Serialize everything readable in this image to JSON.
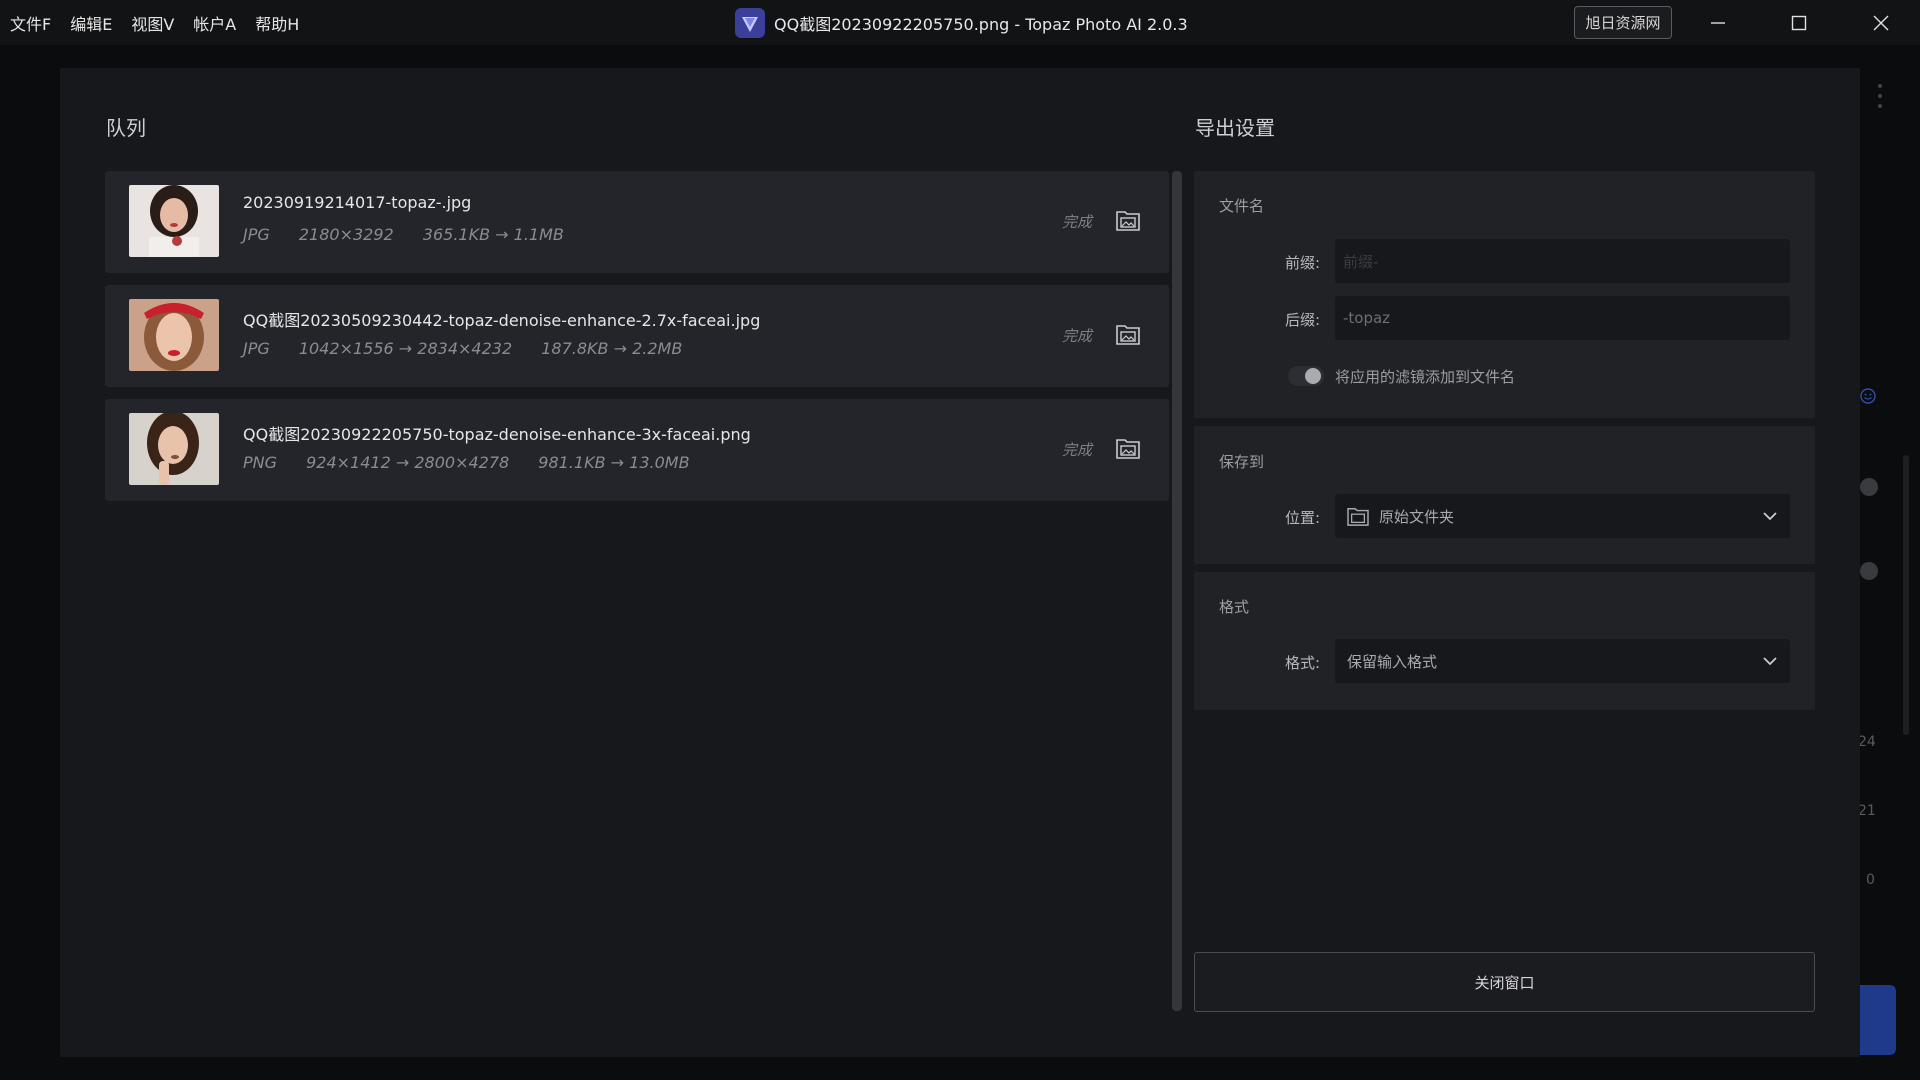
{
  "menu": [
    {
      "label": "文件F"
    },
    {
      "label": "编辑E"
    },
    {
      "label": "视图V"
    },
    {
      "label": "帐户A"
    },
    {
      "label": "帮助H"
    }
  ],
  "window": {
    "title": "QQ截图20230922205750.png - Topaz Photo AI 2.0.3",
    "badge": "旭日资源网"
  },
  "background_numbers": [
    "24",
    "21",
    "0"
  ],
  "queue": {
    "title": "队列",
    "items": [
      {
        "name": "20230919214017-topaz-.jpg",
        "format": "JPG",
        "dimensions": "2180×3292",
        "size": "365.1KB → 1.1MB",
        "status": "完成",
        "thumb_bg": "#e9e4e1",
        "thumb_hair": "#2a1d18",
        "thumb_skin": "#e5bba5",
        "thumb_accent": "#b43c3c"
      },
      {
        "name": "QQ截图20230509230442-topaz-denoise-enhance-2.7x-faceai.jpg",
        "format": "JPG",
        "dimensions": "1042×1556 → 2834×4232",
        "size": "187.8KB → 2.2MB",
        "status": "完成",
        "thumb_bg": "#caa28a",
        "thumb_hair": "#8a5a3a",
        "thumb_skin": "#ecc4ac",
        "thumb_accent": "#c8202c"
      },
      {
        "name": "QQ截图20230922205750-topaz-denoise-enhance-3x-faceai.png",
        "format": "PNG",
        "dimensions": "924×1412 → 2800×4278",
        "size": "981.1KB → 13.0MB",
        "status": "完成",
        "thumb_bg": "#d8d2cc",
        "thumb_hair": "#3a2418",
        "thumb_skin": "#e8c2aa",
        "thumb_accent": "#7a5040"
      }
    ]
  },
  "export": {
    "title": "导出设置",
    "filename": {
      "title": "文件名",
      "prefix_label": "前缀:",
      "prefix_placeholder": "前缀-",
      "suffix_label": "后缀:",
      "suffix_value": "-topaz",
      "toggle_label": "将应用的滤镜添加到文件名"
    },
    "save_to": {
      "title": "保存到",
      "location_label": "位置:",
      "location_value": "原始文件夹"
    },
    "format": {
      "title": "格式",
      "format_label": "格式:",
      "format_value": "保留输入格式"
    },
    "close_label": "关闭窗口"
  }
}
